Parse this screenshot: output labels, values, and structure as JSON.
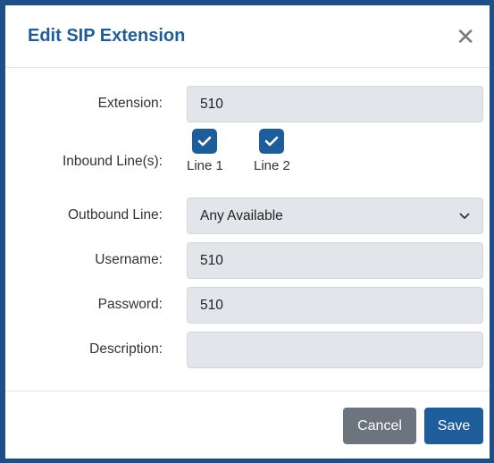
{
  "dialog": {
    "title": "Edit SIP Extension",
    "close_icon": "close-icon"
  },
  "form": {
    "extension": {
      "label": "Extension:",
      "value": "510"
    },
    "inbound": {
      "label": "Inbound Line(s):",
      "lines": [
        {
          "label": "Line 1",
          "checked": true
        },
        {
          "label": "Line 2",
          "checked": true
        }
      ]
    },
    "outbound": {
      "label": "Outbound Line:",
      "value": "Any Available"
    },
    "username": {
      "label": "Username:",
      "value": "510"
    },
    "password": {
      "label": "Password:",
      "value": "510"
    },
    "description": {
      "label": "Description:",
      "value": ""
    }
  },
  "buttons": {
    "cancel": "Cancel",
    "save": "Save"
  },
  "colors": {
    "accent": "#1e5d9c",
    "frame": "#1f4f86",
    "cancel": "#6c757d",
    "field_bg": "#e2e5ea"
  }
}
